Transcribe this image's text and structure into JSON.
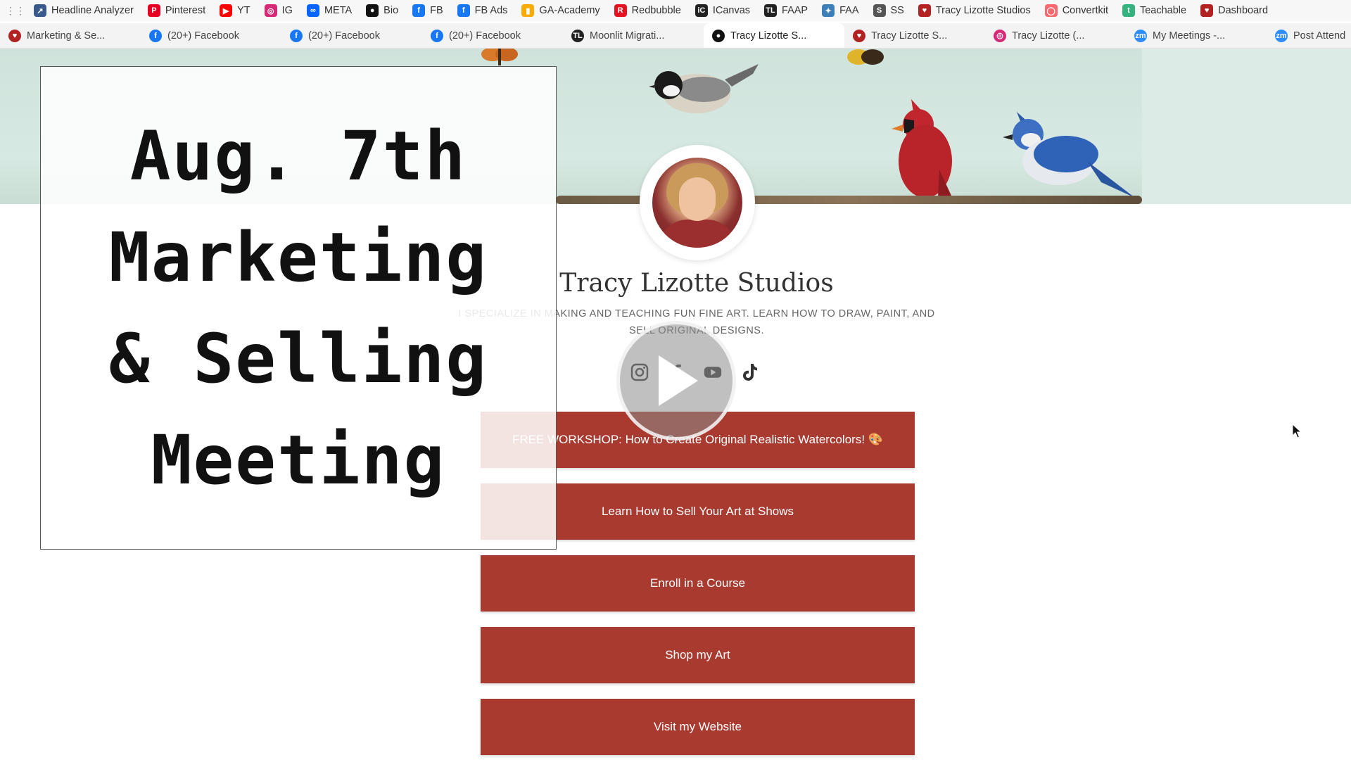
{
  "bookmarks": [
    {
      "label": "Headline Analyzer",
      "icon": "trend-icon",
      "color": "#3a5a8c"
    },
    {
      "label": "Pinterest",
      "icon": "pinterest-icon",
      "color": "#e60023"
    },
    {
      "label": "YT",
      "icon": "youtube-icon",
      "color": "#ff0000"
    },
    {
      "label": "IG",
      "icon": "instagram-icon",
      "color": "#d62976"
    },
    {
      "label": "META",
      "icon": "meta-icon",
      "color": "#0866ff"
    },
    {
      "label": "Bio",
      "icon": "dot-icon",
      "color": "#111111"
    },
    {
      "label": "FB",
      "icon": "facebook-icon",
      "color": "#1877f2"
    },
    {
      "label": "FB Ads",
      "icon": "facebook-icon",
      "color": "#1877f2"
    },
    {
      "label": "GA-Academy",
      "icon": "analytics-icon",
      "color": "#f9ab00"
    },
    {
      "label": "Redbubble",
      "icon": "redbubble-icon",
      "color": "#e41321"
    },
    {
      "label": "ICanvas",
      "icon": "icanvas-icon",
      "color": "#222222"
    },
    {
      "label": "FAAP",
      "icon": "tl-icon",
      "color": "#222222"
    },
    {
      "label": "FAA",
      "icon": "faa-icon",
      "color": "#3d7fb8"
    },
    {
      "label": "SS",
      "icon": "ss-icon",
      "color": "#555555"
    },
    {
      "label": "Tracy Lizotte Studios",
      "icon": "cardinal-icon",
      "color": "#b22222"
    },
    {
      "label": "Convertkit",
      "icon": "convertkit-icon",
      "color": "#fb6970"
    },
    {
      "label": "Teachable",
      "icon": "teachable-icon",
      "color": "#35b37e"
    },
    {
      "label": "Dashboard",
      "icon": "cardinal-icon",
      "color": "#b22222"
    }
  ],
  "tabs": [
    {
      "label": "Marketing & Se...",
      "icon": "cardinal-icon",
      "color": "#b22222",
      "active": false
    },
    {
      "label": "(20+) Facebook",
      "icon": "facebook-icon",
      "color": "#1877f2",
      "active": false
    },
    {
      "label": "(20+) Facebook",
      "icon": "facebook-icon",
      "color": "#1877f2",
      "active": false
    },
    {
      "label": "(20+) Facebook",
      "icon": "facebook-icon",
      "color": "#1877f2",
      "active": false
    },
    {
      "label": "Moonlit Migrati...",
      "icon": "tl-icon",
      "color": "#222222",
      "active": false
    },
    {
      "label": "Tracy Lizotte S...",
      "icon": "dot-icon",
      "color": "#111111",
      "active": true
    },
    {
      "label": "Tracy Lizotte S...",
      "icon": "cardinal-icon",
      "color": "#b22222",
      "active": false
    },
    {
      "label": "Tracy Lizotte (...",
      "icon": "instagram-icon",
      "color": "#d62976",
      "active": false
    },
    {
      "label": "My Meetings -...",
      "icon": "zoom-icon",
      "color": "#2d8cff",
      "active": false
    },
    {
      "label": "Post Attend",
      "icon": "zoom-icon",
      "color": "#2d8cff",
      "active": false
    }
  ],
  "profile": {
    "name": "Tracy Lizotte Studios",
    "bio": "I specialize in making and teaching fun fine art. Learn how to draw, paint, and sell original designs."
  },
  "socials": [
    "instagram-icon",
    "facebook-icon",
    "youtube-icon",
    "tiktok-icon"
  ],
  "links": [
    "FREE WORKSHOP: How to Create Original Realistic Watercolors! 🎨",
    "Learn How to Sell Your Art at Shows",
    "Enroll in a Course",
    "Shop my Art",
    "Visit my Website"
  ],
  "overlay": {
    "title_lines": [
      "Aug. 7th",
      "Marketing",
      "& Selling",
      "Meeting"
    ]
  },
  "colors": {
    "button": "#a83a30",
    "banner": "#d6e9e2"
  }
}
